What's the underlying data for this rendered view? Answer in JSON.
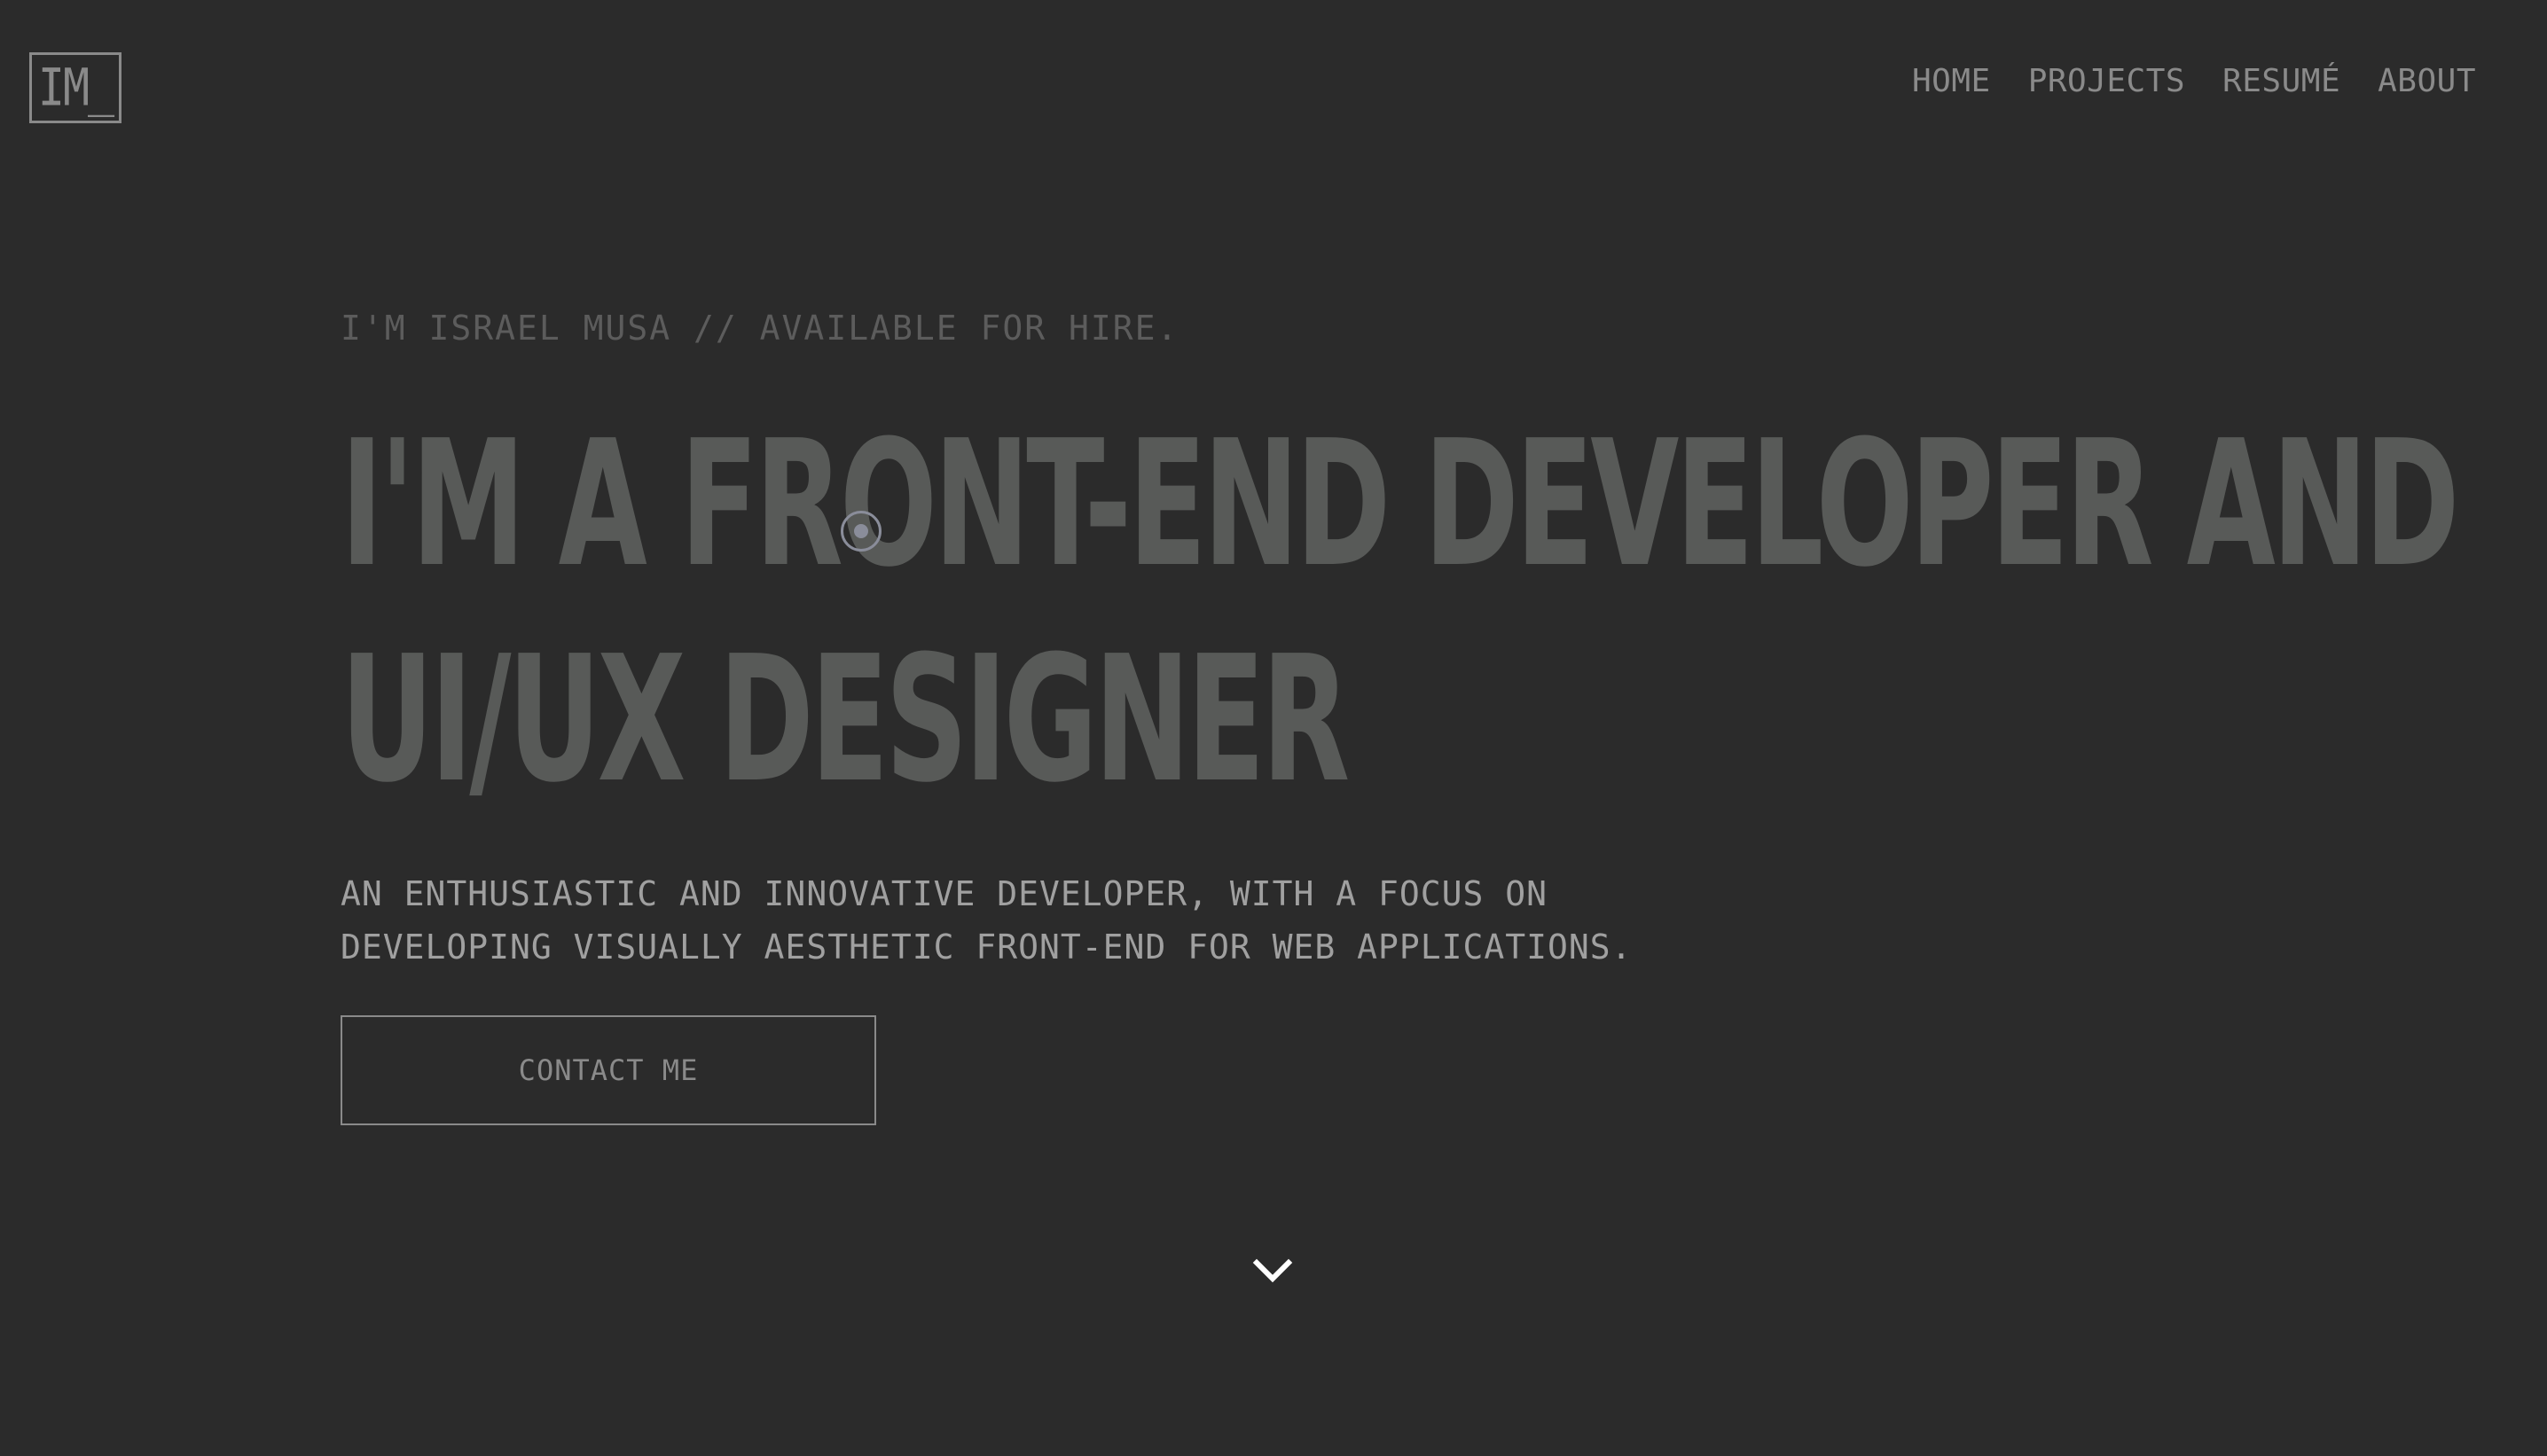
{
  "logo": {
    "text": "IM_"
  },
  "nav": {
    "items": [
      {
        "label": "HOME"
      },
      {
        "label": "PROJECTS"
      },
      {
        "label": "RESUMÉ"
      },
      {
        "label": "ABOUT"
      }
    ]
  },
  "hero": {
    "eyebrow": "I'M ISRAEL MUSA // AVAILABLE FOR HIRE.",
    "headline_line1": "I'M A FRONT-END DEVELOPER AND",
    "headline_line2": "UI/UX DESIGNER",
    "description_line1": "AN ENTHUSIASTIC AND INNOVATIVE DEVELOPER, WITH A FOCUS ON",
    "description_line2": "DEVELOPING VISUALLY AESTHETIC FRONT-END FOR WEB APPLICATIONS.",
    "cta_label": "CONTACT ME"
  },
  "icons": {
    "scroll": "chevron-down-icon",
    "cursor": "cursor-icon"
  },
  "colors": {
    "background": "#2b2b2b",
    "headline": "#585a58",
    "nav": "#8a8a8a",
    "description": "#a0a0a0",
    "eyebrow": "#5c5c5c",
    "chevron": "#ffffff"
  }
}
